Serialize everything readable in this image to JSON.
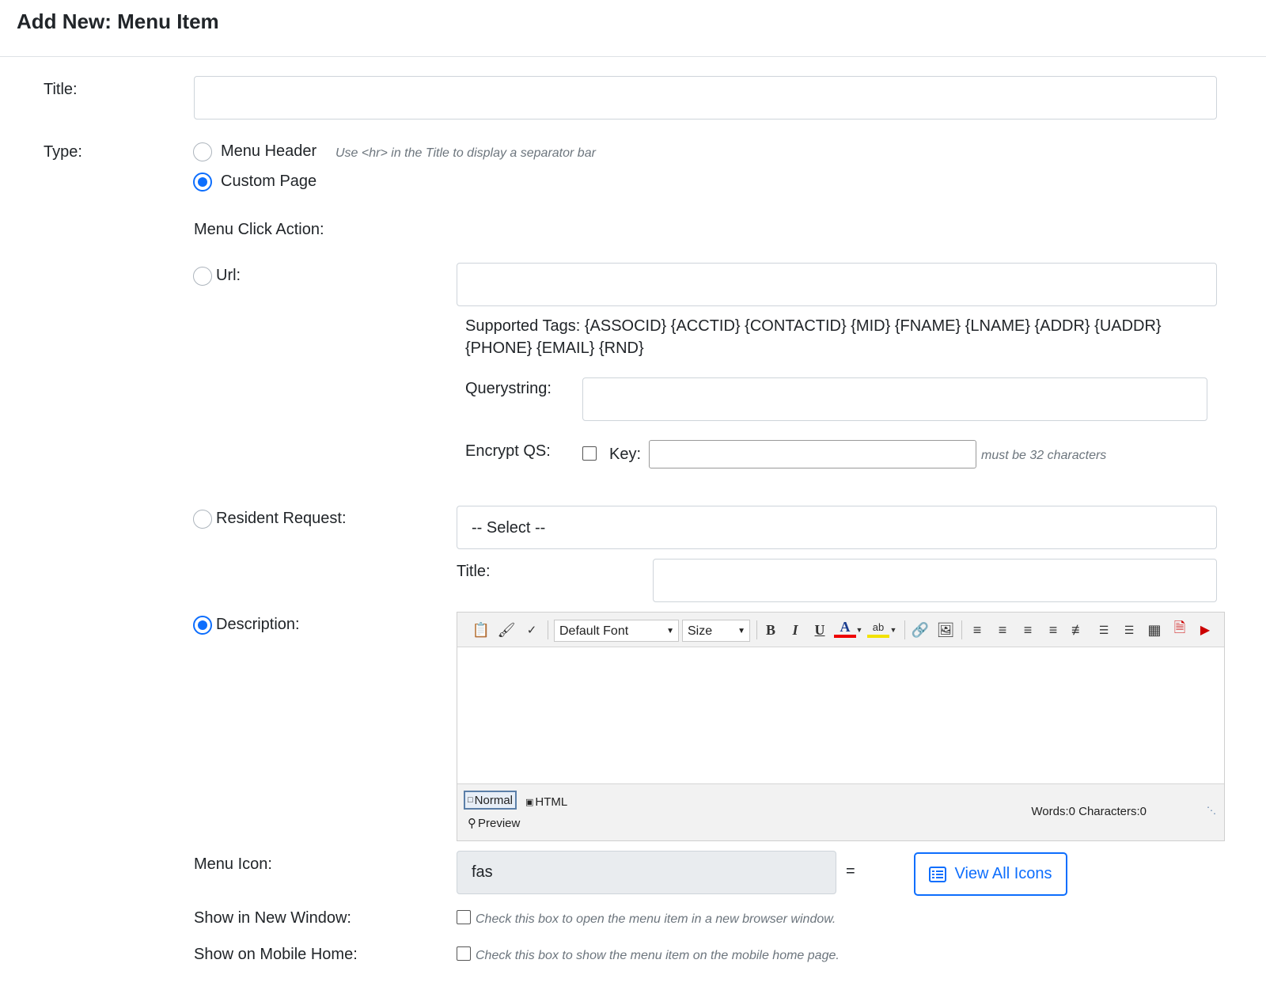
{
  "header": {
    "title": "Add New: Menu Item"
  },
  "form": {
    "title_label": "Title:",
    "title_value": "",
    "type_label": "Type:",
    "type_options": [
      {
        "label": "Menu Header",
        "hint": "Use <hr> in the Title to display a separator bar",
        "selected": false
      },
      {
        "label": "Custom Page",
        "selected": true
      }
    ],
    "menu_click_action_label": "Menu Click Action:",
    "url": {
      "label": "Url:",
      "selected": false,
      "value": "",
      "supported_tags_line1": "Supported Tags: {ASSOCID} {ACCTID} {CONTACTID} {MID} {FNAME} {LNAME} {ADDR} {UADDR}",
      "supported_tags_line2": "{PHONE} {EMAIL} {RND}",
      "querystring_label": "Querystring:",
      "querystring_value": "",
      "encrypt_label": "Encrypt QS:",
      "encrypt_checked": false,
      "key_label": "Key:",
      "key_value": "",
      "key_hint": "must be 32 characters"
    },
    "resident_request": {
      "label": "Resident Request:",
      "selected": false,
      "select_value": "-- Select --",
      "title_label": "Title:",
      "title_value": ""
    },
    "description": {
      "label": "Description:",
      "selected": true,
      "font_select": "Default Font",
      "size_select": "Size",
      "mode_normal": "Normal",
      "mode_html": "HTML",
      "mode_preview": "Preview",
      "stats": "Words:0 Characters:0"
    },
    "menu_icon": {
      "label": "Menu Icon:",
      "value": "fas",
      "equals": "=",
      "view_all_label": "View All Icons"
    },
    "new_window": {
      "label": "Show in New Window:",
      "checked": false,
      "hint": "Check this box to open the menu item in a new browser window."
    },
    "mobile_home": {
      "label": "Show on Mobile Home:",
      "checked": false,
      "hint": "Check this box to show the menu item on the mobile home page."
    }
  },
  "colors": {
    "primary": "#0d6efd",
    "border": "#ced4da",
    "readonly_bg": "#e9ecef",
    "hint": "#6c757d"
  }
}
